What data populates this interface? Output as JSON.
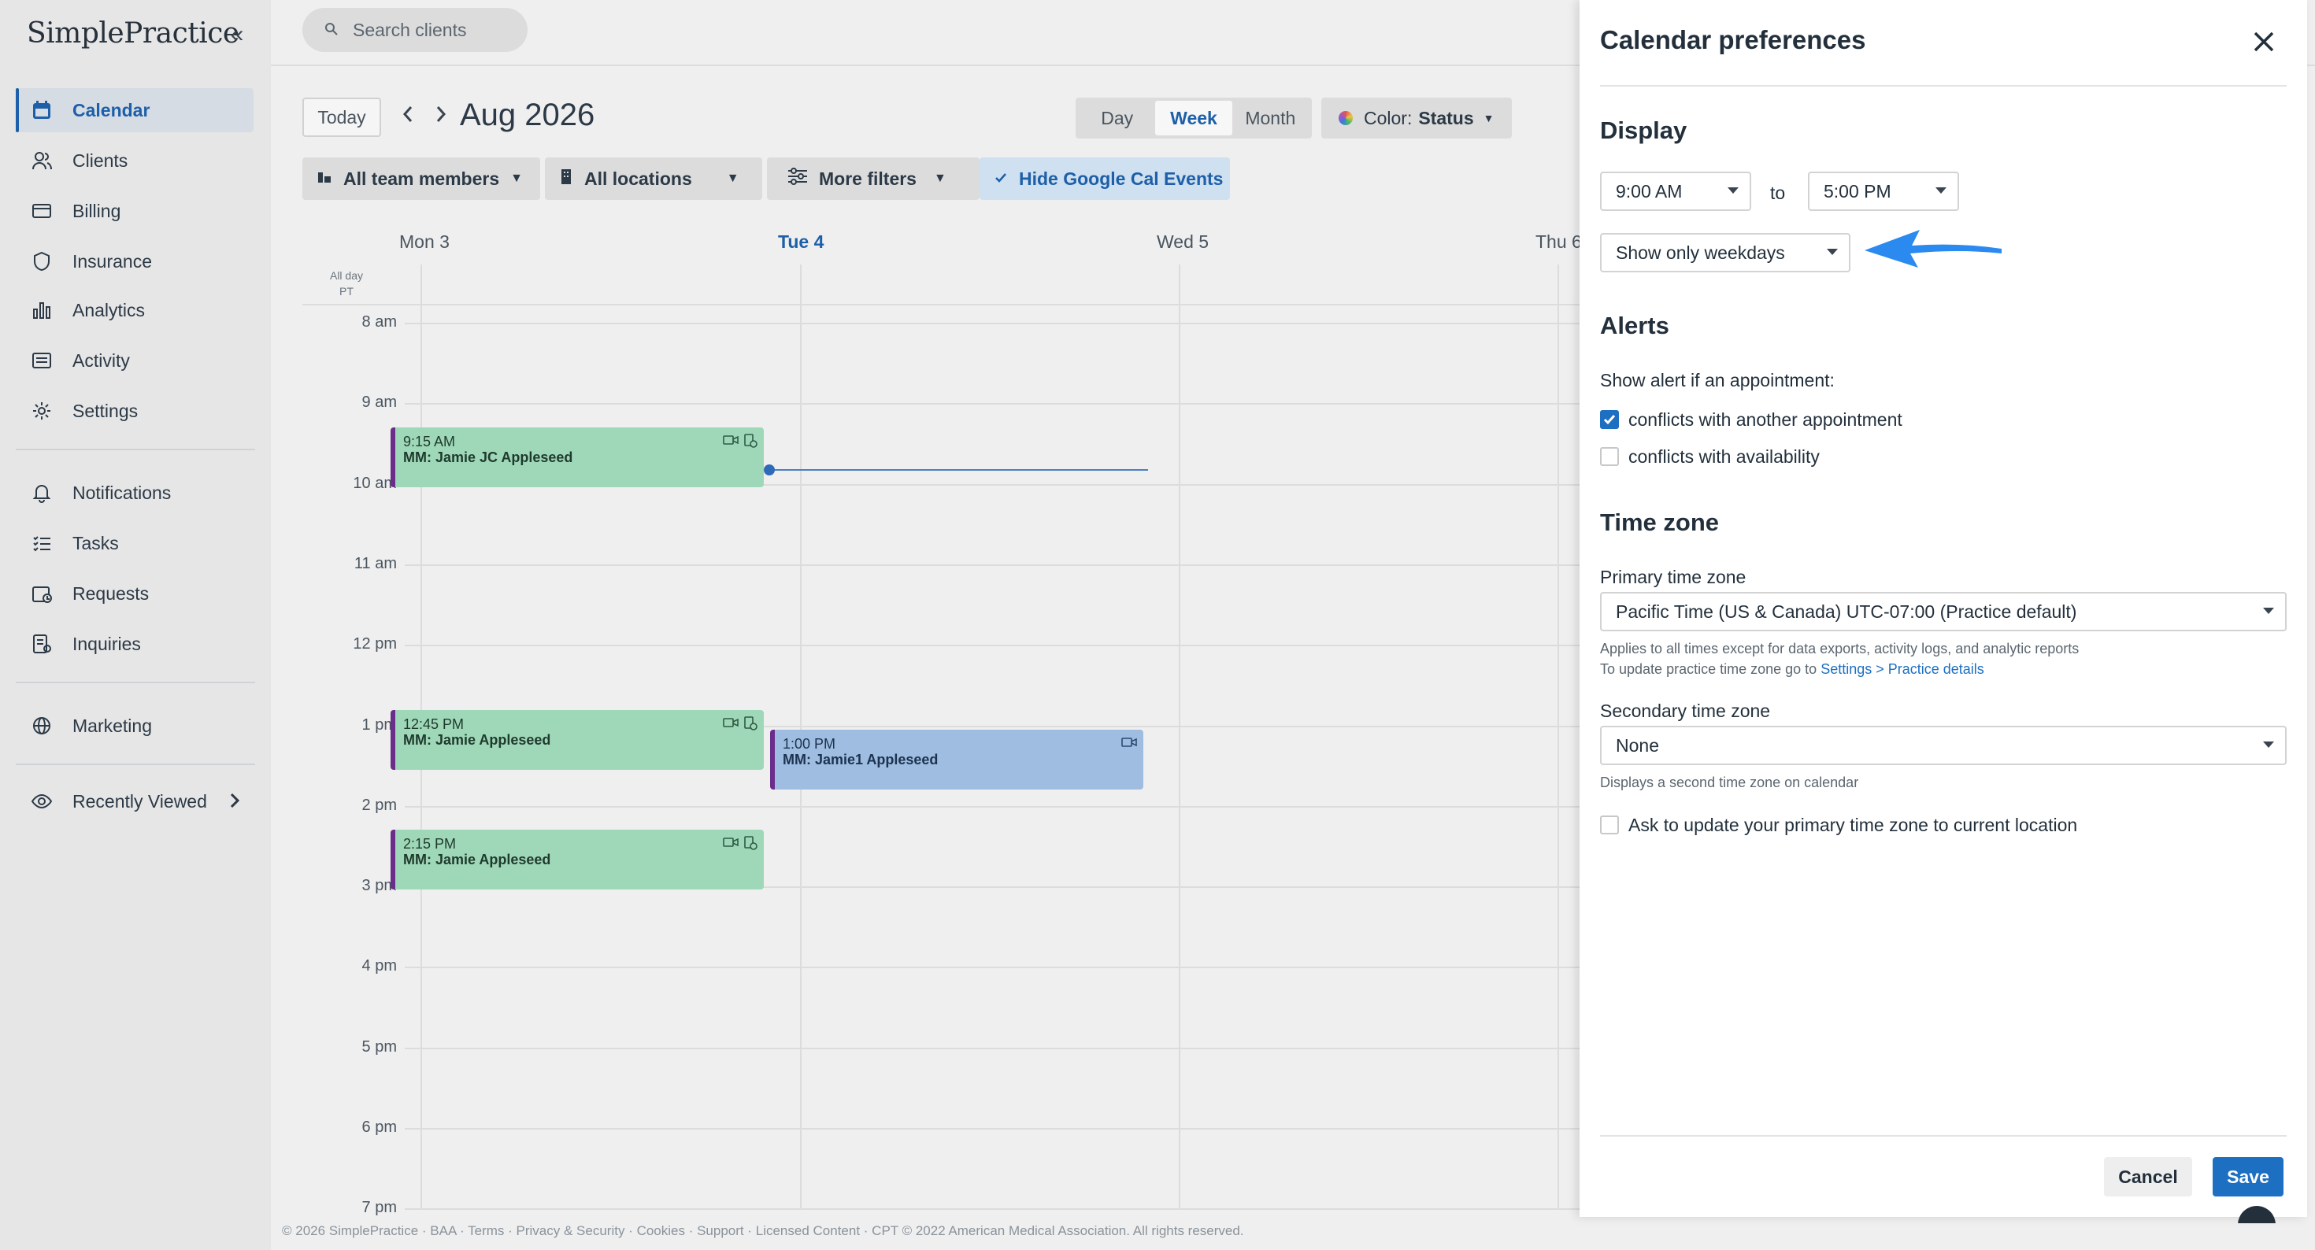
{
  "sidebar": {
    "brand": "SimplePractice",
    "items": [
      {
        "label": "Calendar",
        "icon": "calendar-icon"
      },
      {
        "label": "Clients",
        "icon": "clients-icon"
      },
      {
        "label": "Billing",
        "icon": "billing-icon"
      },
      {
        "label": "Insurance",
        "icon": "shield-icon"
      },
      {
        "label": "Analytics",
        "icon": "analytics-icon"
      },
      {
        "label": "Activity",
        "icon": "activity-icon"
      },
      {
        "label": "Settings",
        "icon": "gear-icon"
      },
      {
        "label": "Notifications",
        "icon": "bell-icon"
      },
      {
        "label": "Tasks",
        "icon": "tasks-icon"
      },
      {
        "label": "Requests",
        "icon": "requests-icon"
      },
      {
        "label": "Inquiries",
        "icon": "inquiries-icon"
      },
      {
        "label": "Marketing",
        "icon": "globe-icon"
      },
      {
        "label": "Recently Viewed",
        "icon": "eye-icon"
      }
    ]
  },
  "search": {
    "placeholder": "Search clients"
  },
  "calendar": {
    "today_label": "Today",
    "month_title": "Aug 2026",
    "views": [
      "Day",
      "Week",
      "Month"
    ],
    "selected_view": "Week",
    "color_prefix": "Color:",
    "color_value": "Status",
    "filters": {
      "team": "All team members",
      "locations": "All locations",
      "more": "More filters",
      "google": "Hide Google Cal Events"
    },
    "days": [
      "Mon 3",
      "Tue 4",
      "Wed 5",
      "Thu 6"
    ],
    "today_day": "Tue 4",
    "allday_label": "All day",
    "tz_label": "PT",
    "hours": [
      "8 am",
      "9 am",
      "10 am",
      "11 am",
      "12 pm",
      "1 pm",
      "2 pm",
      "3 pm",
      "4 pm",
      "5 pm",
      "6 pm",
      "7 pm"
    ],
    "appointments": [
      {
        "time": "9:15 AM",
        "name": "MM: Jamie JC Appleseed"
      },
      {
        "time": "12:45 PM",
        "name": "MM: Jamie Appleseed"
      },
      {
        "time": "2:15 PM",
        "name": "MM: Jamie Appleseed"
      },
      {
        "time": "1:00 PM",
        "name": "MM: Jamie1 Appleseed"
      }
    ]
  },
  "footer": "© 2026 SimplePractice · BAA · Terms · Privacy & Security · Cookies · Support · Licensed Content · CPT © 2022 American Medical Association. All rights reserved.",
  "preferences": {
    "title": "Calendar preferences",
    "display": {
      "heading": "Display",
      "start_time": "9:00 AM",
      "to_label": "to",
      "end_time": "5:00 PM",
      "days_option": "Show only weekdays"
    },
    "alerts": {
      "heading": "Alerts",
      "intro": "Show alert if an appointment:",
      "conflict_appointment": "conflicts with another appointment",
      "conflict_availability": "conflicts with availability"
    },
    "timezone": {
      "heading": "Time zone",
      "primary_label": "Primary time zone",
      "primary_value": "Pacific Time (US & Canada) UTC-07:00 (Practice default)",
      "help_line1": "Applies to all times except for data exports, activity logs, and analytic reports",
      "help_line2_prefix": "To update practice time zone go to",
      "help_link": "Settings > Practice details",
      "secondary_label": "Secondary time zone",
      "secondary_value": "None",
      "secondary_help": "Displays a second time zone on calendar",
      "ask_update": "Ask to update your primary time zone to current location"
    },
    "cancel_label": "Cancel",
    "save_label": "Save"
  }
}
